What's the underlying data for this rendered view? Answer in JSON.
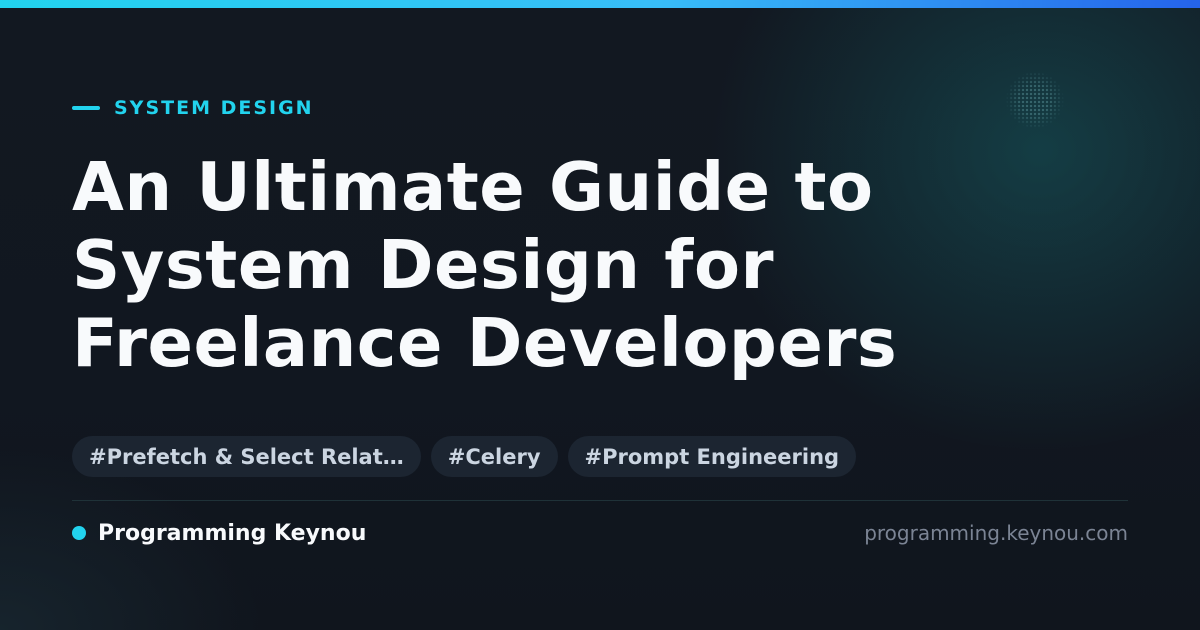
{
  "colors": {
    "accent": "#22d3ee",
    "accent_gradient_end": "#2563eb",
    "background": "#121720",
    "title": "#f8fafc",
    "tag_bg": "#1c2531",
    "tag_text": "#cbd5e1",
    "muted": "#7b8494"
  },
  "category": "SYSTEM DESIGN",
  "title_lines": [
    "An Ultimate Guide to",
    "System Design for",
    "Freelance Developers"
  ],
  "tags": [
    "#Prefetch & Select Relat…",
    "#Celery",
    "#Prompt Engineering"
  ],
  "brand": {
    "name": "Programming Keynou",
    "url": "programming.keynou.com"
  }
}
